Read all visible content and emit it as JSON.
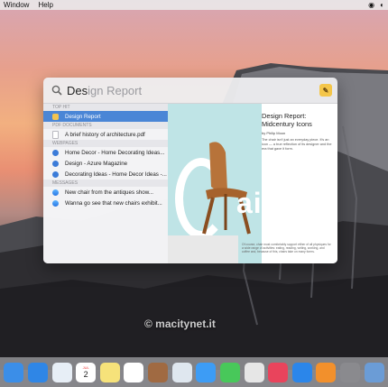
{
  "menubar": {
    "items": [
      "Window",
      "Help"
    ]
  },
  "spotlight": {
    "query": "Des",
    "completion": "ign Report",
    "sections": [
      {
        "title": "TOP HIT",
        "rows": [
          {
            "label": "Design Report",
            "icon": "pages-icon",
            "selected": true
          }
        ]
      },
      {
        "title": "PDF DOCUMENTS",
        "rows": [
          {
            "label": "A brief history of architecture.pdf",
            "icon": "pdf-icon"
          }
        ]
      },
      {
        "title": "WEBPAGES",
        "rows": [
          {
            "label": "Home Decor - Home Decorating Ideas...",
            "icon": "safari-icon"
          },
          {
            "label": "Design - Azure Magazine",
            "icon": "safari-icon"
          },
          {
            "label": "Decorating Ideas - Home Decor Ideas -...",
            "icon": "safari-icon"
          }
        ]
      },
      {
        "title": "MESSAGES",
        "rows": [
          {
            "label": "New chair from the antiques show...",
            "icon": "messages-icon"
          },
          {
            "label": "Wanna go see that new chairs exhibit...",
            "icon": "messages-icon"
          }
        ]
      }
    ],
    "preview": {
      "title": "Design Report: Midcentury Icons",
      "byline": "by Philip Moon",
      "body": "The chair isn't just an everyday piece. It's an icon — a true reflection of its designer and the era that gave it form.",
      "big_text": "airs",
      "bottom_text": "Of course, chair must comfortably support either of all physiques for a wide range of activities: eating, reading, writing, working, and coffee and, because of this, chairs take on many forms."
    }
  },
  "watermark": "© macitynet.it",
  "dock": {
    "apps": [
      "finder-icon",
      "safari-icon",
      "mail-icon",
      "calendar-icon",
      "notes-icon",
      "reminders-icon",
      "contacts-icon",
      "preview-icon",
      "messages-icon",
      "facetime-icon",
      "photos-icon",
      "itunes-icon",
      "app-store-icon",
      "ibooks-icon",
      "system-preferences-icon",
      "downloads-icon"
    ],
    "colors": [
      "#3b8ee8",
      "#2f86e6",
      "#e7eef6",
      "#ffffff",
      "#f6e27a",
      "#ffffff",
      "#a06a42",
      "#dfe7ef",
      "#3d9cf5",
      "#48c85a",
      "#e6e6e6",
      "#e9445c",
      "#2b86ea",
      "#f2902c",
      "#8a8a8e",
      "#6b9cd6"
    ],
    "calendar_day": "2",
    "calendar_month": "JUL"
  }
}
